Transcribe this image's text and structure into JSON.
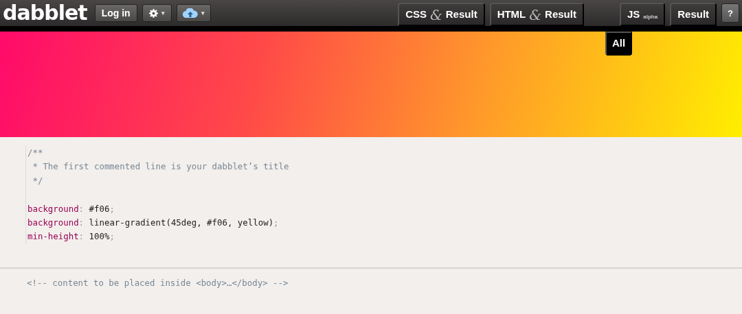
{
  "toolbar": {
    "logo": "dabblet",
    "login": "Log in",
    "settings_caret": "▾",
    "cloud_caret": "▾"
  },
  "view_tabs": [
    {
      "kind": "pair",
      "first": "CSS",
      "joiner": "&",
      "second": "Result"
    },
    {
      "kind": "pair",
      "first": "HTML",
      "joiner": "&",
      "second": "Result"
    },
    {
      "kind": "gap"
    },
    {
      "kind": "single",
      "label": "JS$_{alpha}$"
    },
    {
      "kind": "single",
      "label": "Result"
    },
    {
      "kind": "help",
      "label": "?"
    }
  ],
  "all_button": "All",
  "css_editor": {
    "lines": [
      {
        "kind": "comment",
        "tokens": [
          {
            "kind": "comment",
            "text": "/**"
          }
        ]
      },
      {
        "kind": "comment",
        "tokens": [
          {
            "kind": "comment",
            "text": " * The first commented line is your dabblet’s title"
          }
        ]
      },
      {
        "kind": "comment",
        "tokens": [
          {
            "kind": "comment",
            "text": " */"
          }
        ]
      },
      {
        "kind": "blank"
      },
      {
        "kind": "declaration",
        "tokens": [
          {
            "kind": "property",
            "text": "background"
          },
          {
            "kind": "punct",
            "text": ":"
          },
          {
            "kind": "value",
            "text": " #f06"
          },
          {
            "kind": "punct",
            "text": ";"
          }
        ]
      },
      {
        "kind": "declaration",
        "tokens": [
          {
            "kind": "property",
            "text": "background"
          },
          {
            "kind": "punct",
            "text": ":"
          },
          {
            "kind": "value",
            "text": " linear-gradient(45deg, #f06, yellow)"
          },
          {
            "kind": "punct",
            "text": ";"
          }
        ]
      },
      {
        "kind": "declaration",
        "tokens": [
          {
            "kind": "property",
            "text": "min-height"
          },
          {
            "kind": "punct",
            "text": ":"
          },
          {
            "kind": "value",
            "text": " 100%"
          },
          {
            "kind": "punct",
            "text": ";"
          }
        ]
      }
    ]
  },
  "html_editor": {
    "lines": [
      {
        "kind": "comment",
        "tokens": [
          {
            "kind": "comment",
            "text": "<!-- content to be placed inside <body>…</body> -->"
          }
        ]
      }
    ]
  }
}
